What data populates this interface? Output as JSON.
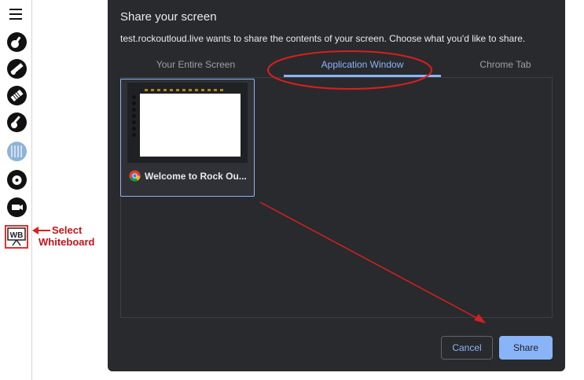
{
  "annotation": {
    "select_line1": "Select",
    "select_line2": "Whiteboard"
  },
  "toolbar": {
    "tools": [
      "guitar-icon",
      "bass-icon",
      "keyboard-icon",
      "guitar2-icon",
      "drums-icon",
      "record-icon",
      "camera-icon",
      "whiteboard-icon"
    ],
    "whiteboard_abbrev": "WB"
  },
  "dialog": {
    "title": "Share your screen",
    "subtitle": "test.rockoutloud.live wants to share the contents of your screen. Choose what you'd like to share.",
    "tabs": [
      {
        "label": "Your Entire Screen",
        "active": false
      },
      {
        "label": "Application Window",
        "active": true
      },
      {
        "label": "Chrome Tab",
        "active": false
      }
    ],
    "window_item": {
      "title": "Welcome to Rock Ou..."
    },
    "cancel_label": "Cancel",
    "share_label": "Share"
  },
  "colors": {
    "accent": "#8ab4f8",
    "dialog_bg": "#292a2d",
    "annotation_red": "#d6201f"
  }
}
